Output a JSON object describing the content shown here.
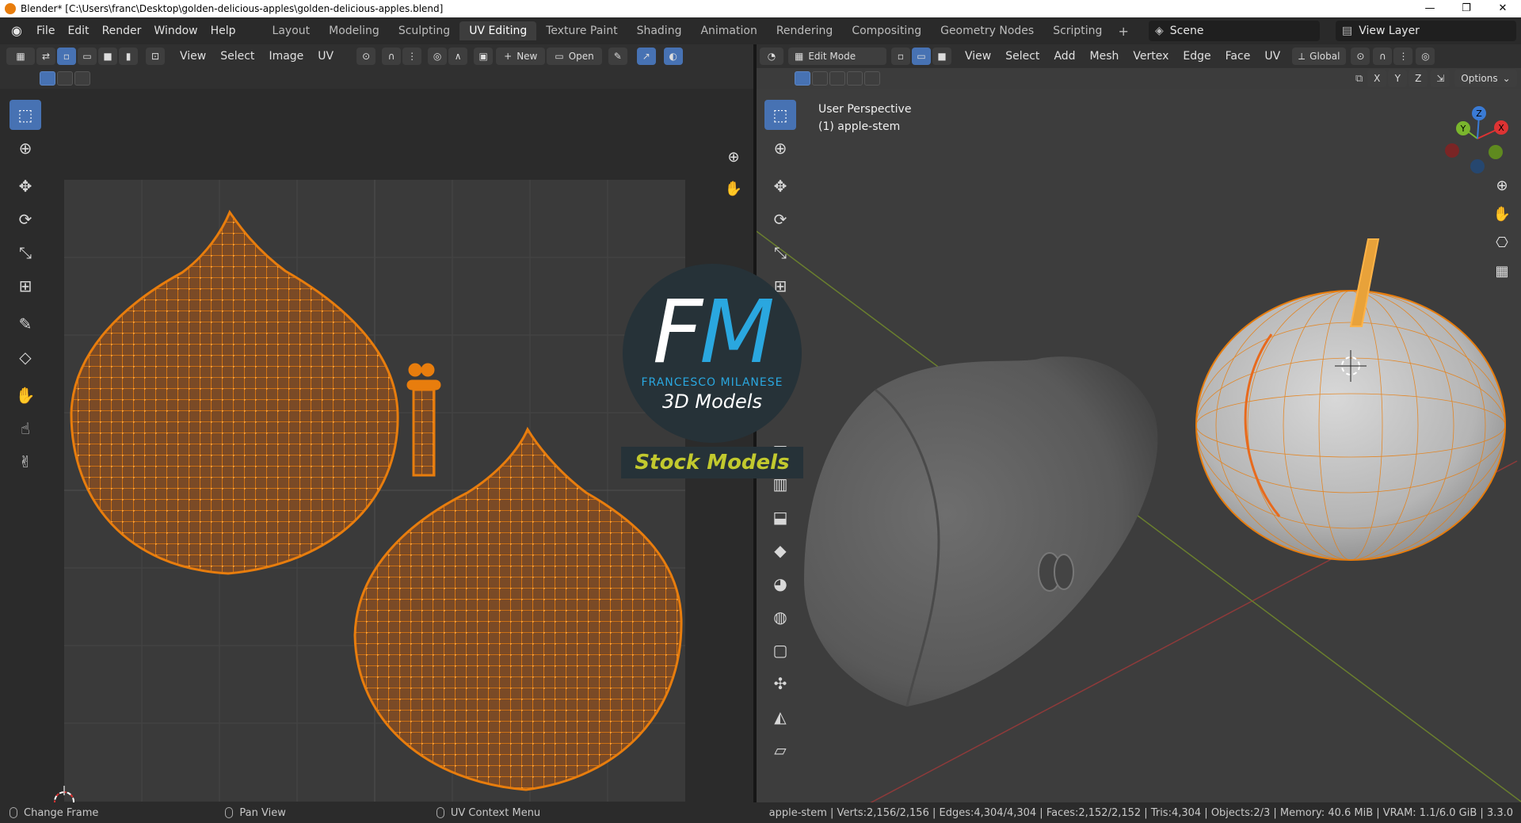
{
  "titlebar": {
    "title": "Blender* [C:\\Users\\franc\\Desktop\\golden-delicious-apples\\golden-delicious-apples.blend]",
    "minimize": "—",
    "restore": "❐",
    "close": "✕"
  },
  "menus": [
    "File",
    "Edit",
    "Render",
    "Window",
    "Help"
  ],
  "workspaces": [
    {
      "label": "Layout",
      "active": false
    },
    {
      "label": "Modeling",
      "active": false
    },
    {
      "label": "Sculpting",
      "active": false
    },
    {
      "label": "UV Editing",
      "active": true
    },
    {
      "label": "Texture Paint",
      "active": false
    },
    {
      "label": "Shading",
      "active": false
    },
    {
      "label": "Animation",
      "active": false
    },
    {
      "label": "Rendering",
      "active": false
    },
    {
      "label": "Compositing",
      "active": false
    },
    {
      "label": "Geometry Nodes",
      "active": false
    },
    {
      "label": "Scripting",
      "active": false
    }
  ],
  "workspace_add": "+",
  "scene": {
    "label": "Scene"
  },
  "view_layer": {
    "label": "View Layer"
  },
  "uv_header": {
    "menus": [
      "View",
      "Select",
      "Image",
      "UV"
    ],
    "new_label": "New",
    "new_plus": "+",
    "open_label": "Open"
  },
  "viewport_header": {
    "mode": "Edit Mode",
    "menus": [
      "View",
      "Select",
      "Add",
      "Mesh",
      "Vertex",
      "Edge",
      "Face",
      "UV"
    ],
    "orientation": "Global",
    "axes": [
      "X",
      "Y",
      "Z"
    ],
    "options": "Options"
  },
  "viewport": {
    "perspective": "User Perspective",
    "object": "(1) apple-stem",
    "gizmo": {
      "x": "X",
      "y": "Y",
      "z": "Z"
    }
  },
  "watermark": {
    "fm_f": "F",
    "fm_m": "M",
    "name": "FRANCESCO MILANESE",
    "sub": "3D Models",
    "stock": "Stock Models"
  },
  "statusbar": {
    "left": [
      {
        "label": "Change Frame"
      },
      {
        "label": "Pan View"
      },
      {
        "label": "UV Context Menu"
      }
    ],
    "stats": "apple-stem | Verts:2,156/2,156 | Edges:4,304/4,304 | Faces:2,152/2,152 | Tris:4,304 | Objects:2/3 | Memory: 40.6 MiB | VRAM: 1.1/6.0 GiB | 3.3.0"
  },
  "colors": {
    "accent": "#4772b3",
    "uv_orange": "#e87d0d",
    "uv_fill": "#7a4a26",
    "wm_blue": "#2aa7df",
    "wm_yellow": "#c2c92e"
  }
}
